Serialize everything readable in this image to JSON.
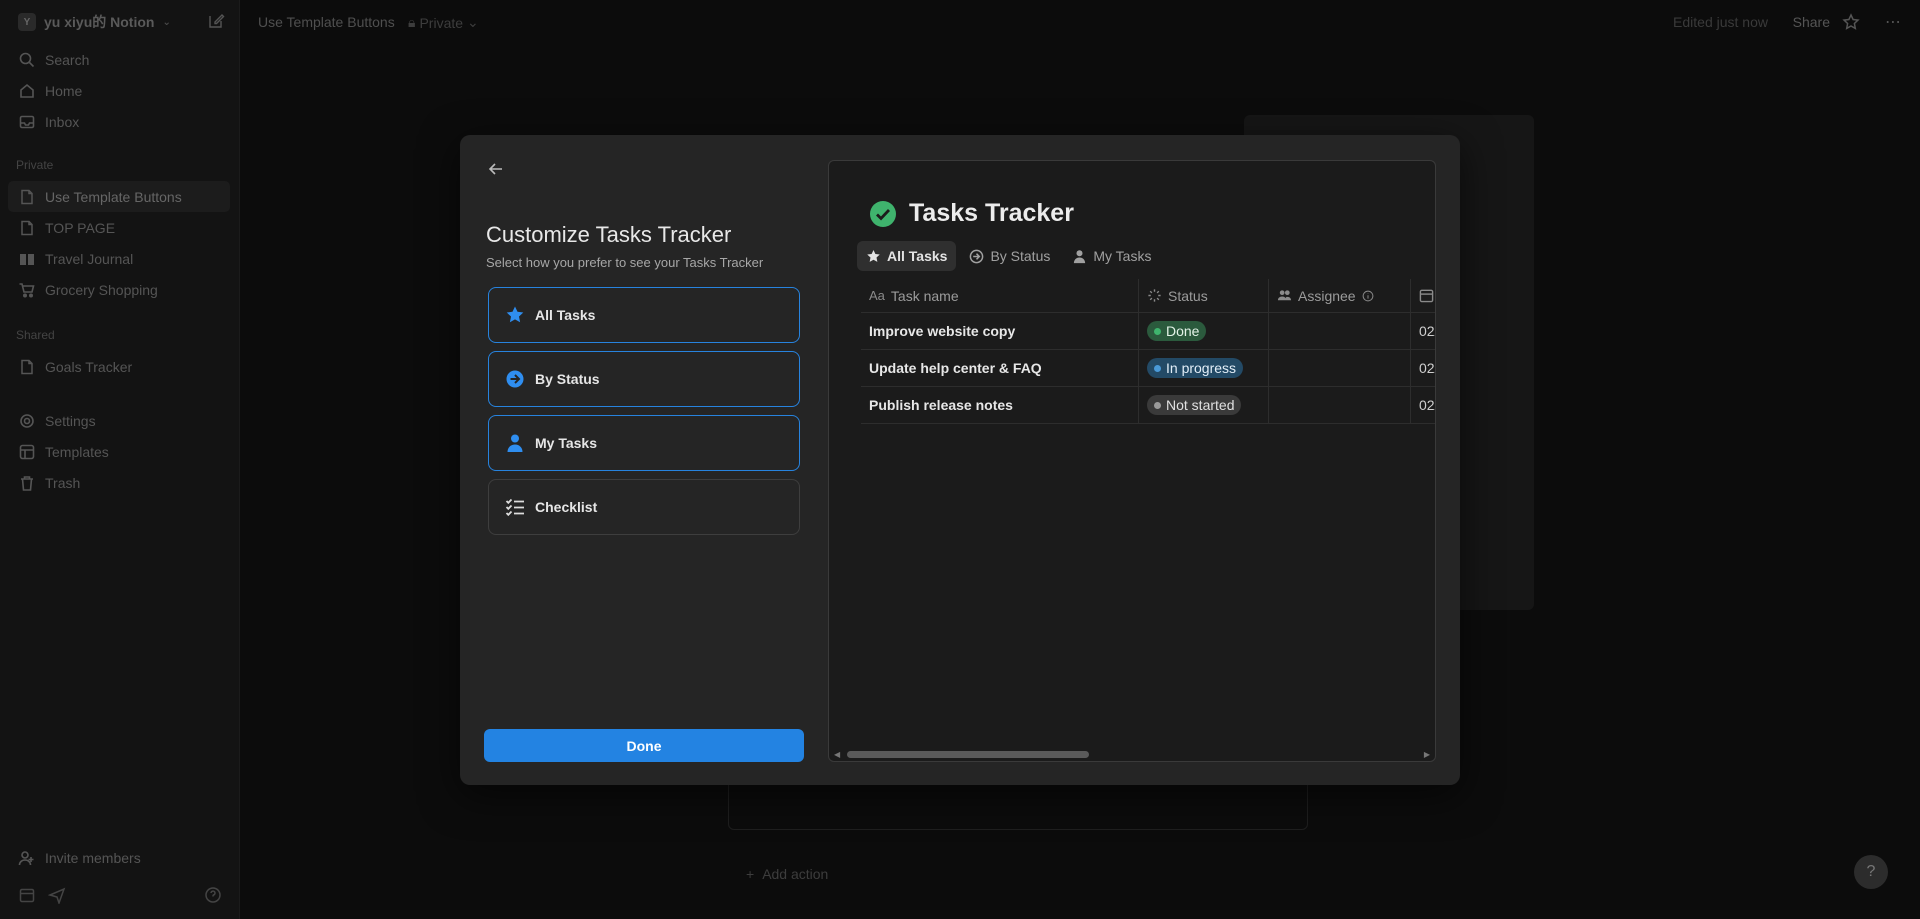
{
  "sidebar": {
    "workspace_initial": "Y",
    "workspace_name": "yu xiyu的 Notion",
    "top_items": [
      {
        "label": "Search"
      },
      {
        "label": "Home"
      },
      {
        "label": "Inbox"
      }
    ],
    "private_heading": "Private",
    "private_items": [
      {
        "label": "Use Template Buttons"
      },
      {
        "label": "TOP PAGE"
      },
      {
        "label": "Travel Journal"
      },
      {
        "label": "Grocery Shopping"
      }
    ],
    "shared_heading": "Shared",
    "shared_items": [
      {
        "label": "Goals Tracker"
      }
    ],
    "bottom_items": [
      {
        "label": "Settings"
      },
      {
        "label": "Templates"
      },
      {
        "label": "Trash"
      }
    ],
    "invite_label": "Invite members"
  },
  "topbar": {
    "breadcrumb": "Use Template Buttons",
    "privacy": "Private",
    "edited": "Edited just now",
    "share": "Share"
  },
  "background": {
    "add_action": "Add action"
  },
  "modal": {
    "title": "Customize Tasks Tracker",
    "subtitle": "Select how you prefer to see your Tasks Tracker",
    "options": [
      {
        "label": "All Tasks",
        "selected": true
      },
      {
        "label": "By Status",
        "selected": true
      },
      {
        "label": "My Tasks",
        "selected": true
      },
      {
        "label": "Checklist",
        "selected": false
      }
    ],
    "done_label": "Done"
  },
  "preview": {
    "title": "Tasks Tracker",
    "tabs": [
      {
        "label": "All Tasks",
        "active": true
      },
      {
        "label": "By Status",
        "active": false
      },
      {
        "label": "My Tasks",
        "active": false
      }
    ],
    "columns": {
      "task": "Task name",
      "status": "Status",
      "assignee": "Assignee"
    },
    "rows": [
      {
        "task": "Improve website copy",
        "status": "Done",
        "date": "02/"
      },
      {
        "task": "Update help center & FAQ",
        "status": "In progress",
        "date": "02/"
      },
      {
        "task": "Publish release notes",
        "status": "Not started",
        "date": "02/"
      }
    ]
  },
  "colors": {
    "accent": "#2383e2",
    "done_bg": "#2b5a3d",
    "done_dot": "#3fb36d",
    "progress_bg": "#234a66",
    "progress_dot": "#4a9ad8",
    "notstarted_bg": "#3a3a3a",
    "notstarted_dot": "#9a9a9a"
  }
}
